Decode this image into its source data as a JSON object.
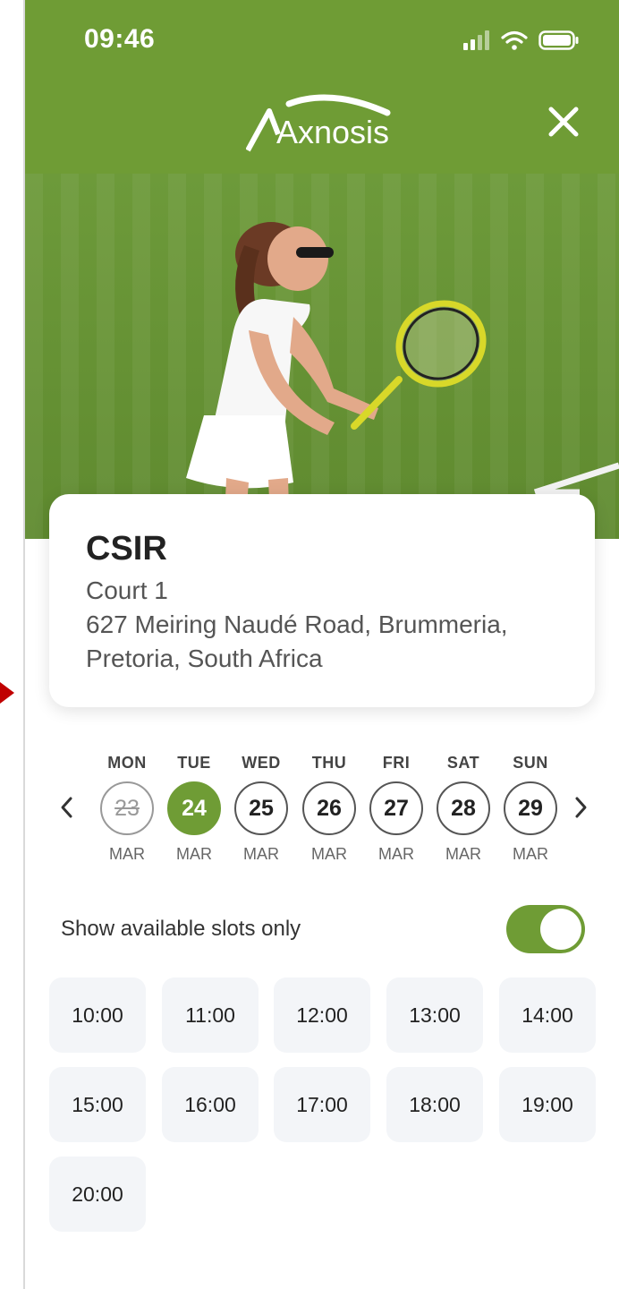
{
  "status_bar": {
    "time": "09:46"
  },
  "header": {
    "brand": "Axnosis",
    "close_icon": "close-icon"
  },
  "venue": {
    "name": "CSIR",
    "court": "Court 1",
    "address_line1": "627 Meiring Naudé Road, Brummeria,",
    "address_line2": "Pretoria, South Africa"
  },
  "calendar": {
    "days": [
      {
        "weekday": "MON",
        "date": "23",
        "month": "MAR",
        "state": "past"
      },
      {
        "weekday": "TUE",
        "date": "24",
        "month": "MAR",
        "state": "selected"
      },
      {
        "weekday": "WED",
        "date": "25",
        "month": "MAR",
        "state": "default"
      },
      {
        "weekday": "THU",
        "date": "26",
        "month": "MAR",
        "state": "default"
      },
      {
        "weekday": "FRI",
        "date": "27",
        "month": "MAR",
        "state": "default"
      },
      {
        "weekday": "SAT",
        "date": "28",
        "month": "MAR",
        "state": "default"
      },
      {
        "weekday": "SUN",
        "date": "29",
        "month": "MAR",
        "state": "default"
      }
    ]
  },
  "filters": {
    "available_only_label": "Show available slots only",
    "available_only": true
  },
  "slots": [
    "10:00",
    "11:00",
    "12:00",
    "13:00",
    "14:00",
    "15:00",
    "16:00",
    "17:00",
    "18:00",
    "19:00",
    "20:00"
  ],
  "colors": {
    "brand_green": "#6f9c35",
    "slot_bg": "#f3f5f8"
  }
}
